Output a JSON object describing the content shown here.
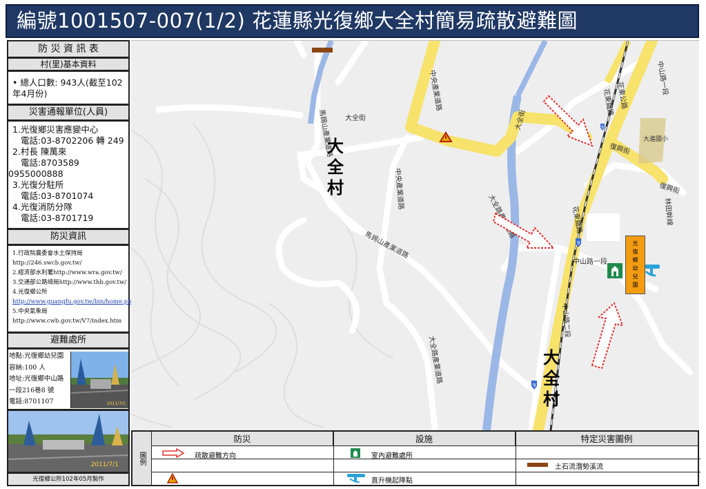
{
  "title": "編號1001507-007(1/2)  花蓮縣光復鄉大全村簡易疏散避難圖",
  "info_panel": {
    "header": "防 災 資 訊 表",
    "basic_header": "村(里)基本資料",
    "population": "• 總人口數: 943人(截至102年4月份)",
    "report_header": "災害通報單位(人員)",
    "report_lines": [
      "1.光復鄉災害應變中心",
      "   電話:03-8702206 轉 249",
      "2.村長 陳萬來",
      "   電話:8703589",
      "0955000888",
      "3.光復分駐所",
      "   電話:03-8701074",
      "4.光復消防分隊",
      "   電話:03-8701719"
    ],
    "resources_header": "防災資訊",
    "resources": [
      "1.行政院農委會水土保持局",
      "http://246.swcb.gov.tw/",
      "2.經濟部水利署http://www.wra.gov.tw/",
      "3.交通部公路總局http://www.thb.gov.tw/",
      "4.光復鄉公所",
      "http://www.guangfu.gov.tw/bin/home.php",
      "5.中央氣象局",
      "http://www.cwb.gov.tw/V7/index.htm"
    ],
    "shelter_header": "避難處所",
    "shelter_lines": [
      "地點:光復鄉幼兒園",
      "容納:100 人",
      "地址:光復鄉中山路",
      "一段216巷8 號",
      "電話:8701107"
    ],
    "photo_date_small": "2011/7/1",
    "photo_date_large": "2011/7/1",
    "footer": "光復鄉公所102年05月製作"
  },
  "map": {
    "village_labels": [
      "大",
      "全",
      "村"
    ],
    "village_labels_2": [
      "大",
      "全",
      "村"
    ],
    "shelter_label": [
      "光",
      "復",
      "鄉",
      "幼",
      "兒",
      "園"
    ],
    "roads": {
      "dachuan_st": "大全街",
      "dachuan_st_2": "大全街",
      "mataian_rd": "馬錫山產業道路",
      "mataian_rd_2": "馬錫山產業道路",
      "central_industrial": "中央產業道路",
      "central_industrial_2": "中央產業道路",
      "dachuan_industrial": "大全路產業道路",
      "dachuan_industrial_2": "大全路產業道路",
      "huadong_rail": "花東鐵路",
      "huadong_rail_2": "花東鐵路",
      "huadong_hwy": "花東公路",
      "zhongshan_1": "中山路一段",
      "zhongshan_1b": "中山路一段",
      "zhongshan_2": "中山路二段",
      "fuxing_st": "復興街",
      "fuxing_st_2": "復興街",
      "linshan_rd": "林田幹線",
      "dajin_school": "大進國小",
      "route_9": "9"
    }
  },
  "legend": {
    "tag": "圖例",
    "col1_header": "防災",
    "col2_header": "設施",
    "col3_header": "特定災害圖例",
    "evac_direction": "疏散避難方向",
    "indoor_shelter": "室內避難處所",
    "helipad": "直升機起降點",
    "debris_flow": "土石流潛勢溪流"
  },
  "colors": {
    "title_bg": "#1f3864",
    "road_yellow": "#f7e26b",
    "evac_arrow": "#e03030",
    "river": "#9bb7e6",
    "shelter_orange": "#f39c12",
    "debris_brown": "#8b4513"
  }
}
